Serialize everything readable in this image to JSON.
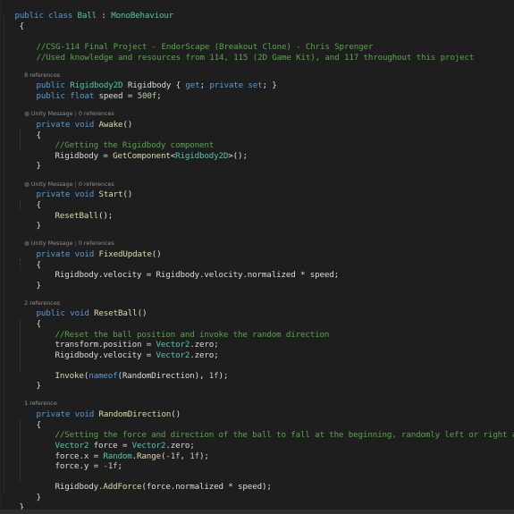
{
  "code": {
    "class_decl": {
      "kw": "public class",
      "name": "Ball",
      "colon": " : ",
      "base": "MonoBehaviour"
    },
    "open_brace_class": "{",
    "comment_1": "//CSG-114 Final Project - EndorScape (Breakout Clone) - Chris Sprenger",
    "comment_2": "//Used knowledge and resources from 114, 115 (2D Game Kit), and 117 throughout this project",
    "rigidbody_refs": "8 references",
    "rigidbody_decl": {
      "kw_public": "public",
      "type": "Rigidbody2D",
      "name": "Rigidbody",
      "rest_open": " { ",
      "kw_get": "get",
      "semi1": "; ",
      "kw_private": "private",
      "kw_set": "set",
      "rest_close": "; }"
    },
    "speed_decl": {
      "kw": "public float",
      "name": "speed",
      "eq": " = ",
      "value": "500f",
      "semi": ";"
    },
    "awake": {
      "lens_unity": "Unity Message",
      "lens_sep": " | ",
      "lens_refs": "0 references",
      "kw": "private void",
      "name": "Awake",
      "parens": "()",
      "open": "{",
      "comment": "//Getting the Rigidbody component",
      "stmt_target": "Rigidbody",
      "stmt_eq": " = ",
      "stmt_method": "GetComponent",
      "stmt_lt": "<",
      "stmt_type": "Rigidbody2D",
      "stmt_end": ">();",
      "close": "}"
    },
    "start": {
      "lens_unity": "Unity Message",
      "lens_sep": " | ",
      "lens_refs": "0 references",
      "kw": "private void",
      "name": "Start",
      "parens": "()",
      "open": "{",
      "stmt_method": "ResetBall",
      "stmt_end": "();",
      "close": "}"
    },
    "fixed_update": {
      "lens_unity": "Unity Message",
      "lens_sep": " | ",
      "lens_refs": "0 references",
      "kw": "private void",
      "name": "FixedUpdate",
      "parens": "()",
      "open": "{",
      "stmt": "Rigidbody.velocity = Rigidbody.velocity.normalized * speed;",
      "close": "}"
    },
    "reset_ball": {
      "lens_refs": "2 references",
      "kw": "public void",
      "name": "ResetBall",
      "parens": "()",
      "open": "{",
      "comment": "//Reset the ball position and invoke the random direction",
      "stmt1_a": "transform.position = ",
      "stmt1_type": "Vector2",
      "stmt1_b": ".zero;",
      "stmt2_a": "Rigidbody.velocity = ",
      "stmt2_type": "Vector2",
      "stmt2_b": ".zero;",
      "invoke_method": "Invoke",
      "invoke_open": "(",
      "invoke_kw": "nameof",
      "invoke_arg": "(RandomDirection), ",
      "invoke_num": "1f",
      "invoke_end": ");",
      "close": "}"
    },
    "random_direction": {
      "lens_refs": "1 reference",
      "kw": "private void",
      "name": "RandomDirection",
      "parens": "()",
      "open": "{",
      "comment": "//Setting the force and direction of the ball to fall at the beginning, randomly left or right and alway",
      "s1_type": "Vector2",
      "s1_var": " force = ",
      "s1_type2": "Vector2",
      "s1_end": ".zero;",
      "s2_a": "force.x = ",
      "s2_type": "Random",
      "s2_dot": ".",
      "s2_method": "Range",
      "s2_open": "(",
      "s2_n1": "-1f",
      "s2_comma": ", ",
      "s2_n2": "1f",
      "s2_end": ");",
      "s3_a": "force.y = ",
      "s3_n": "-1f",
      "s3_end": ";",
      "s4_a": "Rigidbody.",
      "s4_method": "AddForce",
      "s4_b": "(force.normalized * speed);",
      "close": "}"
    },
    "close_brace_class": "}"
  },
  "colors": {
    "background": "#1e1e1e",
    "keyword": "#569cd6",
    "type": "#4ec9b0",
    "method": "#dcdcaa",
    "comment": "#57a64a",
    "number": "#b5cea8",
    "text": "#dcdcdc",
    "codelens": "#8f8f8f"
  }
}
